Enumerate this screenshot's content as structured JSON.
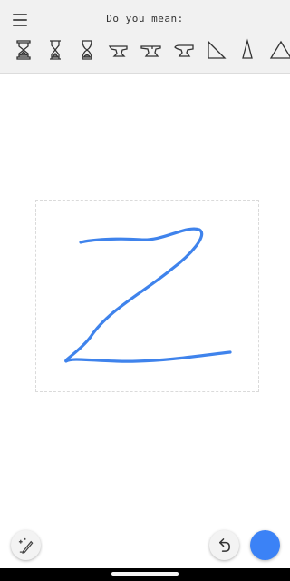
{
  "header": {
    "prompt": "Do you mean:",
    "menu_icon": "hamburger-menu-icon",
    "suggestions": [
      {
        "name": "hourglass-icon-1"
      },
      {
        "name": "hourglass-icon-2"
      },
      {
        "name": "hourglass-icon-3"
      },
      {
        "name": "anvil-icon-1"
      },
      {
        "name": "anvil-icon-2"
      },
      {
        "name": "anvil-icon-3"
      },
      {
        "name": "right-triangle-icon"
      },
      {
        "name": "tall-triangle-icon"
      },
      {
        "name": "triangle-icon"
      }
    ]
  },
  "canvas": {
    "stroke_color": "#3f83ec",
    "background": "#ffffff"
  },
  "toolbar": {
    "autodraw_icon": "autodraw-pencil-sparkle-icon",
    "undo_icon": "undo-icon",
    "current_color": "#3b82f6"
  }
}
